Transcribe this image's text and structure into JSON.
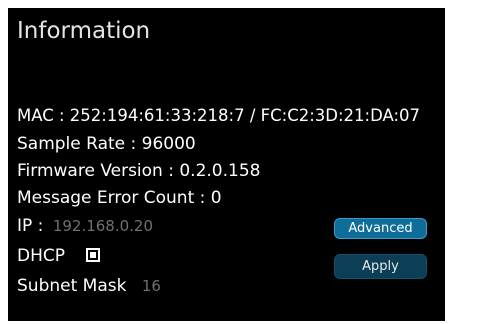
{
  "panel": {
    "title": "Information"
  },
  "info": {
    "mac": "MAC : 252:194:61:33:218:7 / FC:C2:3D:21:DA:07",
    "sample_rate": "Sample Rate : 96000",
    "firmware_version": "Firmware Version : 0.2.0.158",
    "message_error_count": "Message Error Count : 0"
  },
  "network": {
    "ip_label": "IP :",
    "ip_value": "192.168.0.20",
    "dhcp_label": "DHCP",
    "dhcp_checked": true,
    "subnet_label": "Subnet Mask",
    "subnet_value": "16"
  },
  "buttons": {
    "advanced_label": "Advanced",
    "apply_label": "Apply"
  },
  "colors": {
    "panel_background": "#000000",
    "text": "#ffffff",
    "field_text": "#707070",
    "advanced_button": "#0e6d99",
    "apply_button": "#0c3e56"
  }
}
